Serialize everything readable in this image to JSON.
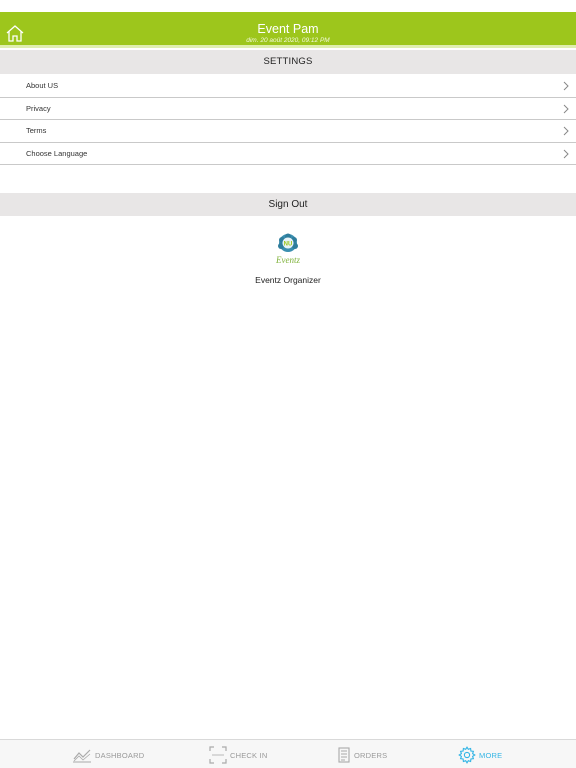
{
  "header": {
    "title": "Event Pam",
    "subtitle": "dim. 20 août 2020, 09:12 PM"
  },
  "settings": {
    "title": "SETTINGS",
    "items": [
      {
        "label": "About US"
      },
      {
        "label": "Privacy"
      },
      {
        "label": "Terms"
      },
      {
        "label": "Choose Language"
      }
    ]
  },
  "signout": {
    "label": "Sign Out"
  },
  "organizer": {
    "logo_text": "Eventz",
    "logo_badge": "NU",
    "name": "Eventz Organizer"
  },
  "tabs": [
    {
      "label": "DASHBOARD",
      "icon": "chart-line-icon",
      "active": false
    },
    {
      "label": "CHECK IN",
      "icon": "scan-frame-icon",
      "active": false
    },
    {
      "label": "ORDERS",
      "icon": "document-list-icon",
      "active": false
    },
    {
      "label": "MORE",
      "icon": "gear-icon",
      "active": true
    }
  ],
  "colors": {
    "header_bg": "#9dc61c",
    "section_bg": "#e8e6e6",
    "tab_active": "#33b5e5",
    "tab_inactive": "#999999"
  }
}
